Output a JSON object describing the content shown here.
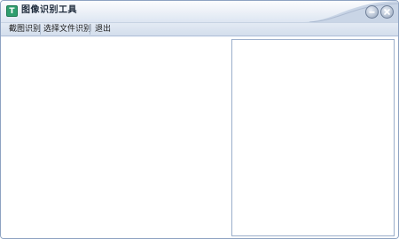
{
  "window": {
    "title": "图像识别工具",
    "app_icon_glyph": "T",
    "controls": [
      "minimize-icon",
      "close-icon"
    ]
  },
  "menu": {
    "items": [
      {
        "label": "截图识别"
      },
      {
        "label": "选择文件识别"
      },
      {
        "label": "退出"
      }
    ]
  },
  "panes": {
    "left": {
      "text": ""
    },
    "right": {
      "text": ""
    }
  },
  "colors": {
    "title_bar": "#eef2f8",
    "menu_bar": "#d8e2ef",
    "border": "#8ea3c2",
    "app_icon": "#2f9e6e"
  }
}
